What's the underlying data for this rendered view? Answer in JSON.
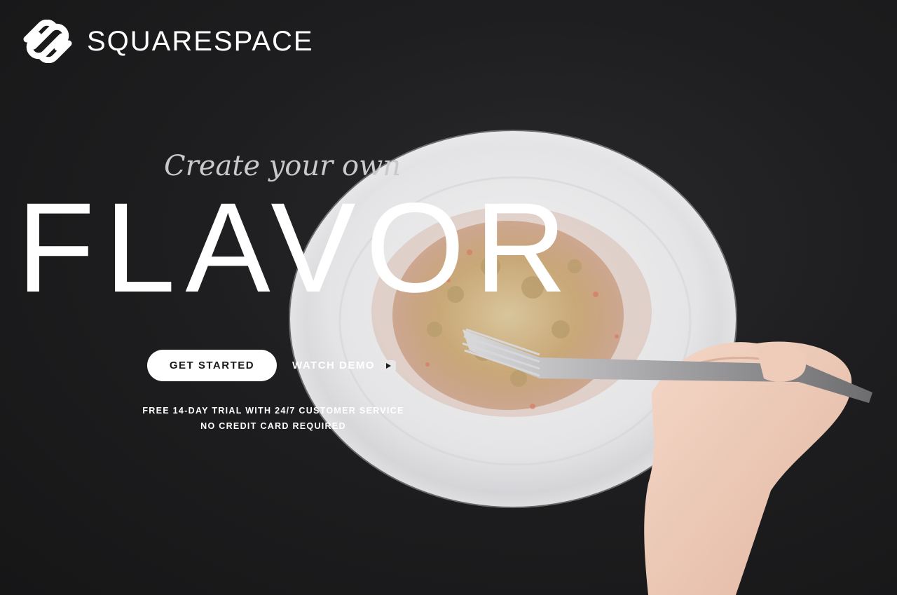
{
  "brand": {
    "name": "SQUARESPACE",
    "logo_icon": "squarespace-logo-icon"
  },
  "hero": {
    "tagline": "Create your own",
    "headline": "FLAVOR"
  },
  "cta": {
    "primary_label": "GET STARTED",
    "secondary_label": "WATCH DEMO",
    "secondary_icon": "play-video-icon"
  },
  "notes": {
    "line1": "FREE 14-DAY TRIAL WITH 24/7 CUSTOMER SERVICE",
    "line2": "NO CREDIT CARD REQUIRED"
  },
  "colors": {
    "background": "#1c1c1d",
    "text": "#ffffff",
    "button_bg": "#ffffff",
    "button_text": "#1a1a1a"
  }
}
